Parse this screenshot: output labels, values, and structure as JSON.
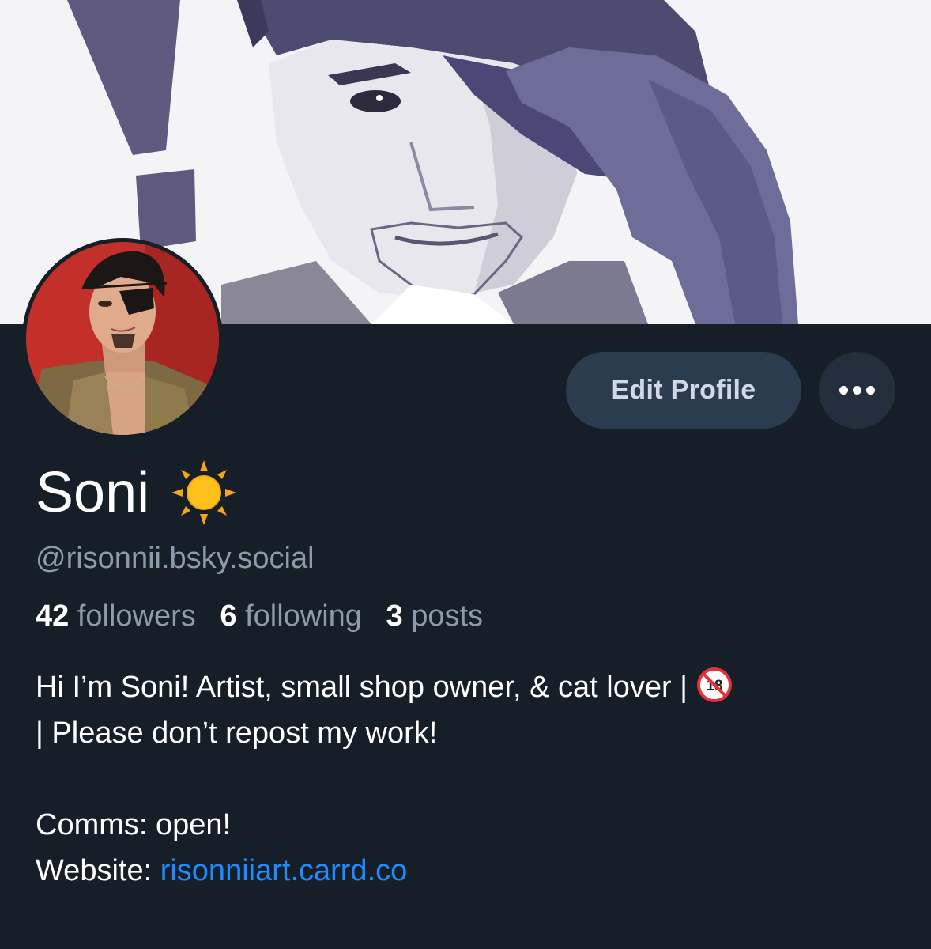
{
  "profile": {
    "display_name": "Soni",
    "name_emoji": "sun-emoji-icon",
    "handle": "@risonnii.bsky.social",
    "stats": {
      "followers_count": "42",
      "followers_label": "followers",
      "following_count": "6",
      "following_label": "following",
      "posts_count": "3",
      "posts_label": "posts"
    },
    "bio": {
      "line1": "Hi I’m Soni! Artist, small shop owner, & cat lover |",
      "line1_icon": "no-under-18-emoji-icon",
      "line2": "| Please don’t repost my work!",
      "line3": "Comms: open!",
      "website_label": "Website:",
      "website_link": "risonniiart.carrd.co"
    }
  },
  "actions": {
    "edit_profile_label": "Edit Profile",
    "more_icon": "ellipsis-icon"
  },
  "colors": {
    "background": "#161e27",
    "edit_button_bg": "#2c3c4f",
    "muted_text": "#8c9bab",
    "link": "#208bfe"
  }
}
